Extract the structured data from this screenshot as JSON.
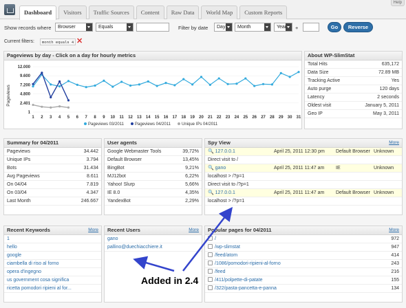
{
  "help": "Help",
  "tabs": [
    "Dashboard",
    "Visitors",
    "Traffic Sources",
    "Content",
    "Raw Data",
    "World Map",
    "Custom Reports"
  ],
  "filter": {
    "show_label": "Show records where",
    "field": "Browser",
    "operator": "Equals",
    "value": "",
    "date_label": "Filter by date",
    "day": "Day",
    "month": "Month",
    "year": "Year",
    "plus": "+",
    "go": "Go",
    "reverse": "Reverse"
  },
  "current_filters": {
    "label": "Current filters:",
    "chip": "month equals 4"
  },
  "pageviews": {
    "title": "Pageviews by day - Click on a day for hourly metrics",
    "ylabel": "Pageviews",
    "yticks": [
      "12.000",
      "9.600",
      "7.200",
      "4.800",
      "2.401",
      "1"
    ],
    "legend": [
      "Pageviews 03/2011",
      "Pageviews 04/2011",
      "Unique IPs 04/2011"
    ]
  },
  "chart_data": {
    "type": "line",
    "ylabel": "Pageviews",
    "ylim": [
      1,
      12000
    ],
    "x": [
      1,
      2,
      3,
      4,
      5,
      6,
      7,
      8,
      9,
      10,
      11,
      12,
      13,
      14,
      15,
      16,
      17,
      18,
      19,
      20,
      21,
      22,
      23,
      24,
      25,
      26,
      27,
      28,
      29,
      30,
      31
    ],
    "series": [
      {
        "name": "Pageviews 03/2011",
        "color": "#33aadd",
        "values": [
          6800,
          9900,
          7300,
          6800,
          8200,
          7200,
          6600,
          7000,
          8300,
          6700,
          8000,
          7000,
          7300,
          8100,
          6900,
          7700,
          7100,
          8700,
          7300,
          9300,
          7200,
          8900,
          7400,
          7500,
          8900,
          6900,
          7400,
          7300,
          10300,
          9300,
          10600
        ]
      },
      {
        "name": "Pageviews 04/2011",
        "color": "#223f9e",
        "values": [
          7400,
          10400,
          3900,
          8100,
          3100
        ]
      },
      {
        "name": "Unique IPs 04/2011",
        "color": "#aaaaaa",
        "values": [
          1900,
          1400,
          1200,
          1500,
          1200
        ]
      }
    ]
  },
  "about": {
    "title": "About WP-SlimStat",
    "rows": [
      [
        "Total Hits",
        "635,172"
      ],
      [
        "Data Size",
        "72.89 MB"
      ],
      [
        "Tracking Active",
        "Yes"
      ],
      [
        "Auto purge",
        "120 days"
      ],
      [
        "Latency",
        "2 seconds"
      ],
      [
        "Oldest visit",
        "January 5, 2011"
      ],
      [
        "Geo IP",
        "May 3, 2011"
      ]
    ]
  },
  "summary": {
    "title": "Summary for 04/2011",
    "rows": [
      [
        "Pageviews",
        "34.442"
      ],
      [
        "Unique IPs",
        "3.794"
      ],
      [
        "Bots",
        "31.434"
      ],
      [
        "Avg Pageviews",
        "8.611"
      ],
      [
        "On 04/04",
        "7.819"
      ],
      [
        "On 03/04",
        "4.347"
      ],
      [
        "Last Month",
        "246.667"
      ]
    ]
  },
  "agents": {
    "title": "User agents",
    "rows": [
      [
        "Google Webmaster Tools",
        "39,72%"
      ],
      [
        "Default Browser",
        "13,45%"
      ],
      [
        "BingBot",
        "9,21%"
      ],
      [
        "MJ12bot",
        "6,22%"
      ],
      [
        "Yahoo! Slurp",
        "5,66%"
      ],
      [
        "IE 8.0",
        "4,35%"
      ],
      [
        "YandexBot",
        "2,29%"
      ]
    ]
  },
  "spy": {
    "title": "Spy View",
    "more": "More",
    "rows": [
      {
        "kind": "ip",
        "ip": "127.0.0.1",
        "date": "April 25, 2011 12:30 pm",
        "browser": "Default Browser",
        "os": "Unknown"
      },
      {
        "kind": "visit",
        "text": "Direct visit to /"
      },
      {
        "kind": "ip",
        "ip": "gano",
        "date": "April 25, 2011 11:47 am",
        "browser": "IE",
        "os": "Unknown"
      },
      {
        "kind": "visit",
        "text": "localhost > /?p=1"
      },
      {
        "kind": "visit",
        "text": "Direct visit to /?p=1"
      },
      {
        "kind": "ip",
        "ip": "127.0.0.1",
        "date": "April 25, 2011 11:47 am",
        "browser": "Default Browser",
        "os": "Unknown"
      },
      {
        "kind": "visit",
        "text": "localhost > /?p=1"
      }
    ]
  },
  "keywords": {
    "title": "Recent Keywords",
    "more": "More",
    "rows": [
      "1",
      "hello",
      "google",
      "ciambella di riso al forno",
      "opera d'ingegno",
      "us government cosa significa",
      "ricetta pomodori ripieni al for..."
    ]
  },
  "users": {
    "title": "Recent Users",
    "more": "More",
    "rows": [
      "gano",
      "pallino@duechiacchiere.it"
    ]
  },
  "popular": {
    "title": "Popular pages for 04/2011",
    "more": "More",
    "rows": [
      [
        "/",
        "972"
      ],
      [
        "/wp-slimstat",
        "947"
      ],
      [
        "/feed/atom",
        "414"
      ],
      [
        "/1086/pomodori-ripieni-al-forno",
        "243"
      ],
      [
        "/feed",
        "216"
      ],
      [
        "/411/polpette-di-patate",
        "155"
      ],
      [
        "/322/pasta-pancetta-e-panna",
        "134"
      ]
    ]
  },
  "annotation": "Added in 2.4"
}
